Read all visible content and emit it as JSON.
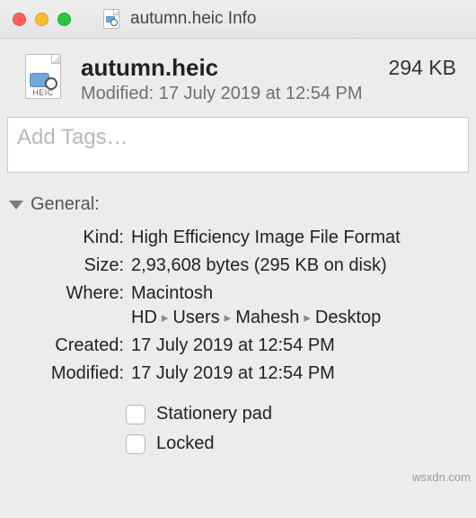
{
  "window": {
    "title": "autumn.heic Info"
  },
  "file": {
    "name": "autumn.heic",
    "ext_label": "HEIC",
    "size_display": "294 KB",
    "modified_line": "Modified: 17 July 2019 at 12:54 PM"
  },
  "tags": {
    "placeholder": "Add Tags…"
  },
  "sections": {
    "general": {
      "title": "General:",
      "kind_label": "Kind:",
      "kind_value": "High Efficiency Image File Format",
      "size_label": "Size:",
      "size_value": "2,93,608 bytes (295 KB on disk)",
      "where_label": "Where:",
      "where_path": [
        "Macintosh HD",
        "Users",
        "Mahesh",
        "Desktop"
      ],
      "created_label": "Created:",
      "created_value": "17 July 2019 at 12:54 PM",
      "modified_label": "Modified:",
      "modified_value": "17 July 2019 at 12:54 PM",
      "stationery_label": "Stationery pad",
      "stationery_checked": false,
      "locked_label": "Locked",
      "locked_checked": false
    }
  },
  "watermark": "wsxdn.com"
}
